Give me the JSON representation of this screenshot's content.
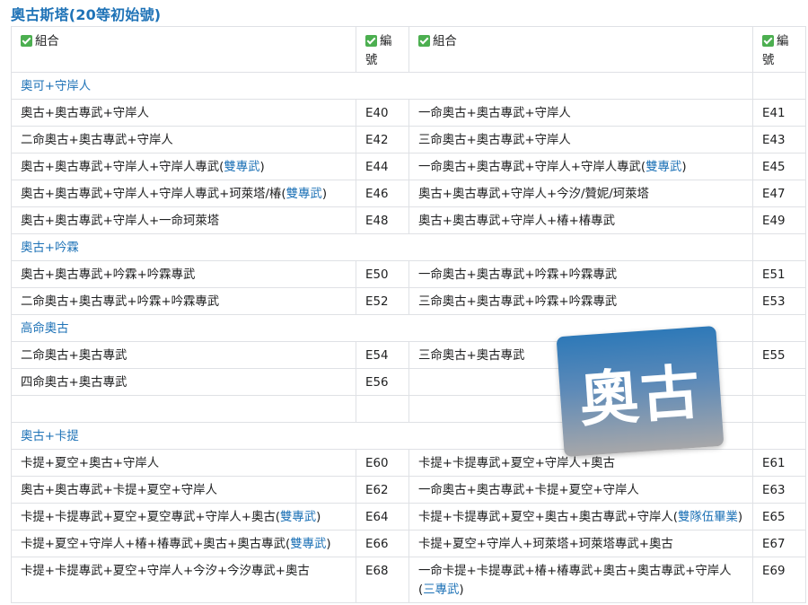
{
  "title": "奧古斯塔(20等初始號)",
  "headers": {
    "combo1": "組合",
    "num1": "編號",
    "combo2": "組合",
    "num2": "編號"
  },
  "sections": [
    {
      "label": "奧可+守岸人",
      "rows": [
        {
          "c1": [
            {
              "t": "奧古+奧古專武+守岸人"
            }
          ],
          "n1": "E40",
          "c2": [
            {
              "t": "一命奧古+奧古專武+守岸人"
            }
          ],
          "n2": "E41"
        },
        {
          "c1": [
            {
              "t": "二命奧古+奧古專武+守岸人"
            }
          ],
          "n1": "E42",
          "c2": [
            {
              "t": "三命奧古+奧古專武+守岸人"
            }
          ],
          "n2": "E43"
        },
        {
          "c1": [
            {
              "t": "奧古+奧古專武+守岸人+守岸人專武("
            },
            {
              "t": "雙專武",
              "link": true
            },
            {
              "t": ")"
            }
          ],
          "n1": "E44",
          "c2": [
            {
              "t": "一命奧古+奧古專武+守岸人+守岸人專武("
            },
            {
              "t": "雙專武",
              "link": true
            },
            {
              "t": ")"
            }
          ],
          "n2": "E45"
        },
        {
          "c1": [
            {
              "t": "奧古+奧古專武+守岸人+守岸人專武+珂萊塔/椿("
            },
            {
              "t": "雙專武",
              "link": true
            },
            {
              "t": ")"
            }
          ],
          "n1": "E46",
          "c2": [
            {
              "t": "奧古+奧古專武+守岸人+今汐/贊妮/珂萊塔"
            }
          ],
          "n2": "E47"
        },
        {
          "c1": [
            {
              "t": "奧古+奧古專武+守岸人+一命珂萊塔"
            }
          ],
          "n1": "E48",
          "c2": [
            {
              "t": "奧古+奧古專武+守岸人+椿+椿專武"
            }
          ],
          "n2": "E49"
        }
      ]
    },
    {
      "label": "奧古+吟霖",
      "rows": [
        {
          "c1": [
            {
              "t": "奧古+奧古專武+吟霖+吟霖專武"
            }
          ],
          "n1": "E50",
          "c2": [
            {
              "t": "一命奧古+奧古專武+吟霖+吟霖專武"
            }
          ],
          "n2": "E51"
        },
        {
          "c1": [
            {
              "t": "二命奧古+奧古專武+吟霖+吟霖專武"
            }
          ],
          "n1": "E52",
          "c2": [
            {
              "t": "三命奧古+奧古專武+吟霖+吟霖專武"
            }
          ],
          "n2": "E53"
        }
      ]
    },
    {
      "label": "高命奧古",
      "rows": [
        {
          "c1": [
            {
              "t": "二命奧古+奧古專武"
            }
          ],
          "n1": "E54",
          "c2": [
            {
              "t": "三命奧古+奧古專武"
            }
          ],
          "n2": "E55"
        },
        {
          "c1": [
            {
              "t": "四命奧古+奧古專武"
            }
          ],
          "n1": "E56",
          "c2": [],
          "n2": ""
        },
        {
          "c1": [],
          "n1": "",
          "c2": [],
          "n2": ""
        }
      ]
    },
    {
      "label": "奧古+卡提",
      "rows": [
        {
          "c1": [
            {
              "t": "卡提+夏空+奧古+守岸人"
            }
          ],
          "n1": "E60",
          "c2": [
            {
              "t": "卡提+卡提專武+夏空+守岸人+奧古"
            }
          ],
          "n2": "E61"
        },
        {
          "c1": [
            {
              "t": "奧古+奧古專武+卡提+夏空+守岸人"
            }
          ],
          "n1": "E62",
          "c2": [
            {
              "t": "一命奧古+奧古專武+卡提+夏空+守岸人"
            }
          ],
          "n2": "E63"
        },
        {
          "c1": [
            {
              "t": "卡提+卡提專武+夏空+夏空專武+守岸人+奧古("
            },
            {
              "t": "雙專武",
              "link": true
            },
            {
              "t": ")"
            }
          ],
          "n1": "E64",
          "c2": [
            {
              "t": "卡提+卡提專武+夏空+奧古+奧古專武+守岸人("
            },
            {
              "t": "雙隊伍畢業",
              "link": true
            },
            {
              "t": ")"
            }
          ],
          "n2": "E65"
        },
        {
          "c1": [
            {
              "t": "卡提+夏空+守岸人+椿+椿專武+奧古+奧古專武("
            },
            {
              "t": "雙專武",
              "link": true
            },
            {
              "t": ")"
            }
          ],
          "n1": "E66",
          "c2": [
            {
              "t": "卡提+夏空+守岸人+珂萊塔+珂萊塔專武+奧古"
            }
          ],
          "n2": "E67"
        },
        {
          "c1": [
            {
              "t": "卡提+卡提專武+夏空+守岸人+今汐+今汐專武+奧古"
            }
          ],
          "n1": "E68",
          "c2": [
            {
              "t": "一命卡提+卡提專武+椿+椿專武+奧古+奧古專武+守岸人("
            },
            {
              "t": "三專武",
              "link": true
            },
            {
              "t": ")"
            }
          ],
          "n2": "E69"
        }
      ]
    }
  ],
  "overlay": {
    "text": "奧古"
  },
  "colors": {
    "accent": "#1f73b7",
    "check": "#4caf50"
  }
}
